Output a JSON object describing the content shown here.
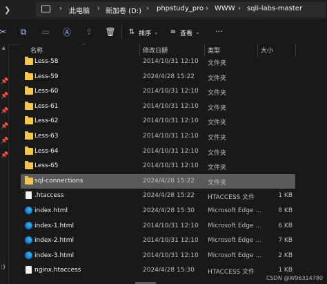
{
  "breadcrumb": [
    "此电脑",
    "新加卷 (D:)",
    "phpstudy_pro",
    "WWW",
    "sqli-labs-master"
  ],
  "toolbar": {
    "sort_label": "排序",
    "view_label": "查看"
  },
  "columns": {
    "name": "名称",
    "date": "修改日期",
    "type": "类型",
    "size": "大小"
  },
  "rows": [
    {
      "icon": "folder-icon",
      "name": "Less-58",
      "date": "2014/10/31 12:10",
      "type": "文件夹",
      "size": ""
    },
    {
      "icon": "folder-icon",
      "name": "Less-59",
      "date": "2024/4/28 15:22",
      "type": "文件夹",
      "size": ""
    },
    {
      "icon": "folder-icon",
      "name": "Less-60",
      "date": "2014/10/31 12:10",
      "type": "文件夹",
      "size": ""
    },
    {
      "icon": "folder-icon",
      "name": "Less-61",
      "date": "2014/10/31 12:10",
      "type": "文件夹",
      "size": ""
    },
    {
      "icon": "folder-icon",
      "name": "Less-62",
      "date": "2014/10/31 12:10",
      "type": "文件夹",
      "size": ""
    },
    {
      "icon": "folder-icon",
      "name": "Less-63",
      "date": "2014/10/31 12:10",
      "type": "文件夹",
      "size": ""
    },
    {
      "icon": "folder-icon",
      "name": "Less-64",
      "date": "2014/10/31 12:10",
      "type": "文件夹",
      "size": ""
    },
    {
      "icon": "folder-icon",
      "name": "Less-65",
      "date": "2014/10/31 12:10",
      "type": "文件夹",
      "size": ""
    },
    {
      "icon": "folder-icon",
      "name": "sql-connections",
      "date": "2024/4/28 15:22",
      "type": "文件夹",
      "size": "",
      "selected": true
    },
    {
      "icon": "file-icon",
      "name": ".htaccess",
      "date": "2024/4/28 15:22",
      "type": "HTACCESS 文件",
      "size": "1 KB"
    },
    {
      "icon": "edge-icon",
      "name": "index.html",
      "date": "2024/4/28 15:30",
      "type": "Microsoft Edge ...",
      "size": "8 KB"
    },
    {
      "icon": "edge-icon",
      "name": "index-1.html",
      "date": "2014/10/31 12:10",
      "type": "Microsoft Edge ...",
      "size": "6 KB"
    },
    {
      "icon": "edge-icon",
      "name": "index-2.html",
      "date": "2014/10/31 12:10",
      "type": "Microsoft Edge ...",
      "size": "7 KB"
    },
    {
      "icon": "edge-icon",
      "name": "index-3.html",
      "date": "2014/10/31 12:10",
      "type": "Microsoft Edge ...",
      "size": "2 KB"
    },
    {
      "icon": "file-icon",
      "name": "nginx.htaccess",
      "date": "2024/4/28 15:30",
      "type": "HTACCESS 文件",
      "size": "1 KB"
    }
  ],
  "watermark": "CSDN @W96314780",
  "colors": {
    "selection": "#5a5a5a",
    "folder": "#f3c64d",
    "background": "#191919"
  }
}
